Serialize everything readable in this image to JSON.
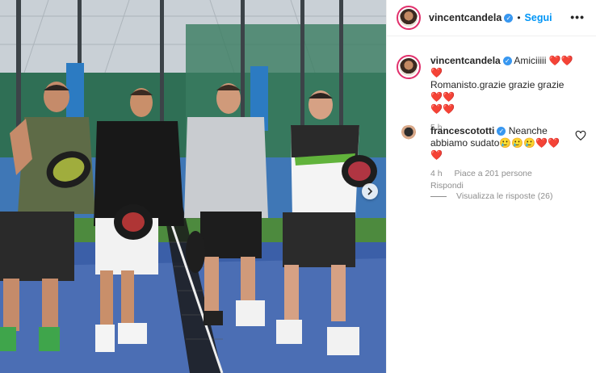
{
  "post": {
    "author": "vincentcandela",
    "follow_label": "Segui",
    "more_label": "•••",
    "caption_text": "Amiciiiii",
    "caption_line2": "Romanisto.grazie grazie grazie",
    "caption_hearts_1": "❤️❤️❤️",
    "caption_hearts_2": "❤️❤️",
    "caption_hearts_3": "❤️❤️",
    "caption_time": "5 h"
  },
  "comment": {
    "author": "francescototti",
    "text_line1": "Neanche",
    "text_line2": "abbiamo sudato",
    "emojis": "🥲🥲🥲",
    "hearts_inline": "❤️❤️",
    "hearts_line3": "❤️",
    "time": "4 h",
    "likes": "Piace a 201 persone",
    "reply_label": "Rispondi",
    "view_replies": "Visualizza le risposte (26)"
  },
  "colors": {
    "accent": "#0095f6",
    "verified": "#3897f0",
    "heart": "#e0245e",
    "court": "#3b5fa8"
  },
  "icons": [
    "verified-icon",
    "more-icon",
    "heart-icon",
    "chevron-right-icon"
  ]
}
